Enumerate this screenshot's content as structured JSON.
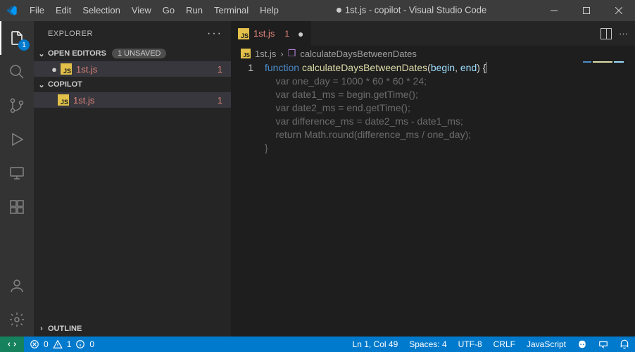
{
  "menu": {
    "file": "File",
    "edit": "Edit",
    "selection": "Selection",
    "view": "View",
    "go": "Go",
    "run": "Run",
    "terminal": "Terminal",
    "help": "Help"
  },
  "title": {
    "modified": "●",
    "text": "1st.js - copilot - Visual Studio Code"
  },
  "activity": {
    "explorer_badge": "1"
  },
  "sidebar": {
    "title": "EXPLORER",
    "open_editors": {
      "label": "OPEN EDITORS",
      "unsaved": "1 UNSAVED"
    },
    "open_file": {
      "name": "1st.js",
      "num": "1"
    },
    "folder": {
      "label": "COPILOT"
    },
    "folder_file": {
      "name": "1st.js",
      "num": "1"
    },
    "outline": {
      "label": "OUTLINE"
    }
  },
  "tab": {
    "name": "1st.js",
    "num": "1",
    "mod": "●"
  },
  "breadcrumb": {
    "file": "1st.js",
    "symbol": "calculateDaysBetweenDates"
  },
  "code": {
    "lineno": "1",
    "l1": {
      "kw": "function",
      "fn": "calculateDaysBetweenDates",
      "open": "(",
      "a1": "begin",
      "comma": ", ",
      "a2": "end",
      "close": ") ",
      "brace": "{"
    },
    "ghost1": "    var one_day = 1000 * 60 * 60 * 24;",
    "ghost2": "    var date1_ms = begin.getTime();",
    "ghost3": "    var date2_ms = end.getTime();",
    "ghost4": "    var difference_ms = date2_ms - date1_ms;",
    "ghost5": "    return Math.round(difference_ms / one_day);",
    "ghost6": "}"
  },
  "status": {
    "errors": "0",
    "warnings": "1",
    "info": "0",
    "lncol": "Ln 1, Col 49",
    "spaces": "Spaces: 4",
    "enc": "UTF-8",
    "eol": "CRLF",
    "lang": "JavaScript"
  }
}
